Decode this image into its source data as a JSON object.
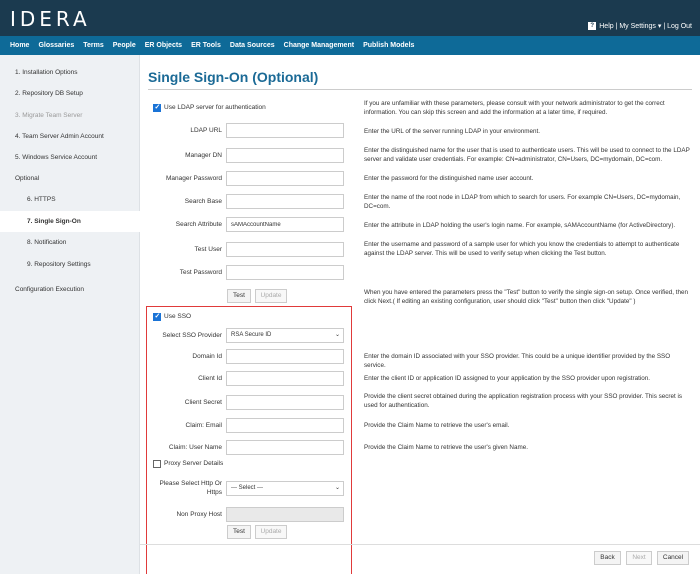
{
  "header": {
    "logo_main": "IDERA",
    "help": "Help | My Settings ▾ | Log Out"
  },
  "nav": {
    "items": [
      "Home",
      "Glossaries",
      "Terms",
      "People",
      "ER Objects",
      "ER Tools",
      "Data Sources",
      "Change Management",
      "Publish Models"
    ]
  },
  "sidebar": {
    "items": [
      {
        "label": "1. Installation Options"
      },
      {
        "label": "2. Repository DB Setup"
      },
      {
        "label": "3. Migrate Team Server"
      },
      {
        "label": "4. Team Server Admin Account"
      },
      {
        "label": "5. Windows Service Account"
      },
      {
        "label": "Optional"
      },
      {
        "label": "6. HTTPS"
      },
      {
        "label": "7. Single Sign-On"
      },
      {
        "label": "8. Notification"
      },
      {
        "label": "9. Repository Settings"
      },
      {
        "label": "Configuration Execution"
      }
    ]
  },
  "page": {
    "title": "Single Sign-On (Optional)",
    "intro": "If you are unfamiliar with these parameters, please consult with your network administrator to get the correct information. You can skip this screen and add the information at a later time, if required."
  },
  "ldap": {
    "checkbox_label": "Use LDAP server for authentication",
    "fields": [
      {
        "label": "LDAP URL",
        "value": "",
        "desc": "Enter the URL of the server running LDAP in your environment."
      },
      {
        "label": "Manager DN",
        "value": "",
        "desc": "Enter the distinguished name for the user that is used to authenticate users. This will be used to connect to the LDAP server and validate user credentials. For example: CN=administrator, CN=Users, DC=mydomain, DC=com."
      },
      {
        "label": "Manager Password",
        "value": "",
        "desc": "Enter the password for the distinguished name user account."
      },
      {
        "label": "Search Base",
        "value": "",
        "desc": "Enter the name of the root node in LDAP from which to search for users. For example CN=Users, DC=mydomain, DC=com."
      },
      {
        "label": "Search Attribute",
        "value": "sAMAccountName",
        "desc": "Enter the attribute in LDAP holding the user's login name. For example, sAMAccountName (for ActiveDirectory)."
      },
      {
        "label": "Test User",
        "value": "",
        "desc": "Enter the username and password of a sample user for which you know the credentials to attempt to authenticate against the LDAP server. This will be used to verify setup when clicking the Test button."
      },
      {
        "label": "Test Password",
        "value": ""
      }
    ],
    "test_label": "Test",
    "update_label": "Update",
    "test_desc": "When you have entered the parameters press the \"Test\" button to verify the single sign-on setup. Once verified, then click Next.( If editing an existing configuration, user should click \"Test\" button then click \"Update\" )"
  },
  "sso": {
    "checkbox_label": "Use SSO",
    "provider_label": "Select SSO Provider",
    "provider_value": "RSA Secure ID",
    "fields": [
      {
        "label": "Domain Id",
        "value": "",
        "desc": "Enter the domain ID associated with your SSO provider. This could be a unique identifier provided by the SSO service."
      },
      {
        "label": "Client Id",
        "value": "",
        "desc": "Enter the client ID or application ID assigned to your application by the SSO provider upon registration."
      },
      {
        "label": "Client Secret",
        "value": "",
        "desc": "Provide the client secret obtained during the application registration process with your SSO provider. This secret is used for authentication."
      },
      {
        "label": "Claim: Email",
        "value": "",
        "desc": "Provide the Claim Name to retrieve the user's email."
      },
      {
        "label": "Claim: User Name",
        "value": "",
        "desc": "Provide the Claim Name to retrieve the user's given Name."
      }
    ],
    "proxy_label": "Proxy Server Details",
    "http_label_1": "Please Select Http Or",
    "http_label_2": "Https",
    "http_value": "--- Select ---",
    "nonproxy_label": "Non Proxy Host",
    "test_label": "Test",
    "update_label": "Update"
  },
  "footer": {
    "back": "Back",
    "next": "Next",
    "cancel": "Cancel"
  }
}
